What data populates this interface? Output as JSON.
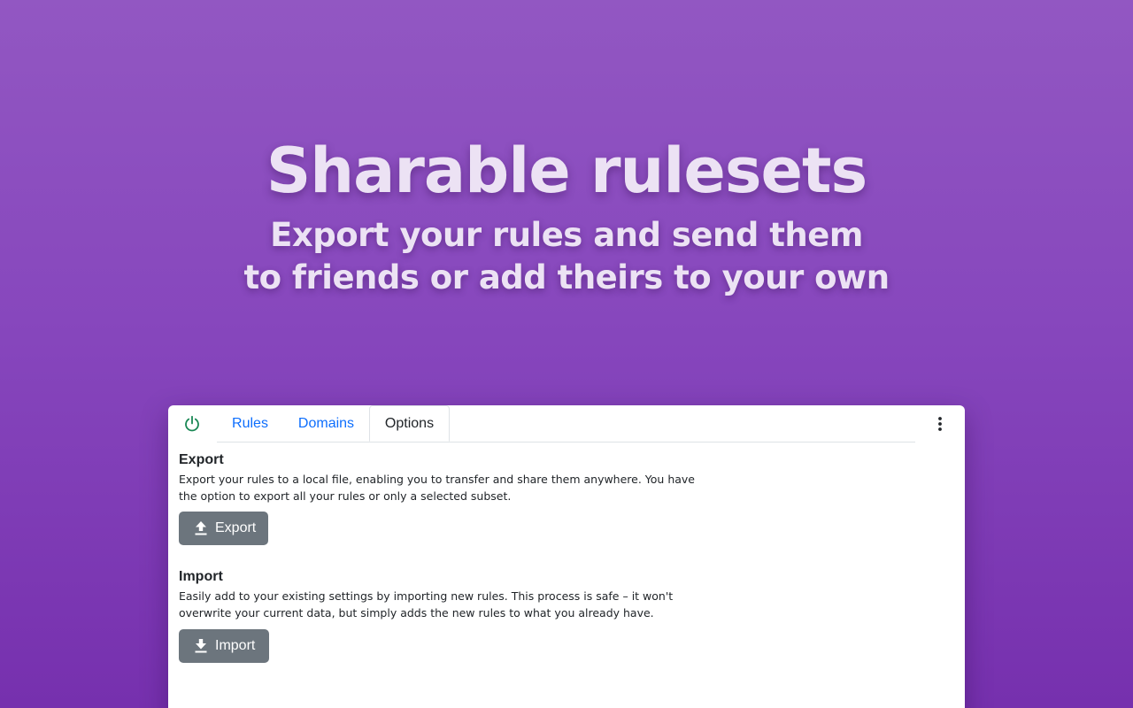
{
  "hero": {
    "title": "Sharable rulesets",
    "subtitle_line1": "Export your rules and send them",
    "subtitle_line2": "to friends or add theirs to your own"
  },
  "tabs": [
    {
      "label": "Rules",
      "active": false
    },
    {
      "label": "Domains",
      "active": false
    },
    {
      "label": "Options",
      "active": true
    }
  ],
  "toolbar": {
    "power_icon": "power-icon",
    "power_color": "#198754",
    "more_icon": "more-vertical-icon"
  },
  "export_section": {
    "title": "Export",
    "description": "Export your rules to a local file, enabling you to transfer and share them anywhere. You have the option to export all your rules or only a selected subset.",
    "button_label": "Export",
    "button_icon": "upload-icon"
  },
  "import_section": {
    "title": "Import",
    "description": "Easily add to your existing settings by importing new rules. This process is safe – it won't overwrite your current data, but simply adds the new rules to what you already have.",
    "button_label": "Import",
    "button_icon": "download-icon"
  },
  "colors": {
    "background_top": "#9257c2",
    "background_bottom": "#7630ae",
    "tab_link": "#0d6efd",
    "button_secondary": "#6c757d"
  }
}
